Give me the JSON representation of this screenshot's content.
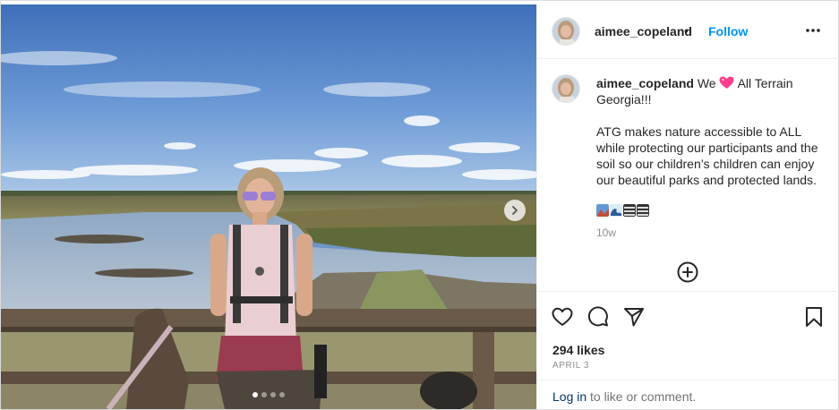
{
  "post": {
    "username": "aimee_copeland",
    "separator": "•",
    "follow_label": "Follow",
    "more_icon": "more-options-icon"
  },
  "caption": {
    "username": "aimee_copeland",
    "line1_before_emoji": "We",
    "line1_after_emoji": "All Terrain Georgia!!!",
    "paragraph2": "ATG makes nature accessible to ALL while protecting our participants and the soil so our children’s children can enjoy our beautiful parks and protected lands.",
    "emoji_colors": [
      "#2f6fb8",
      "#2c4f7c",
      "#555555",
      "#444444"
    ],
    "time": "10w"
  },
  "carousel": {
    "total": 4,
    "active": 1
  },
  "engagement": {
    "likes": "294 likes",
    "date": "APRIL 3",
    "login_link": "Log in",
    "login_rest": "to like or comment."
  },
  "colors": {
    "accent": "#0095f6",
    "link": "#00376b",
    "heart": "#ff3d8b"
  }
}
